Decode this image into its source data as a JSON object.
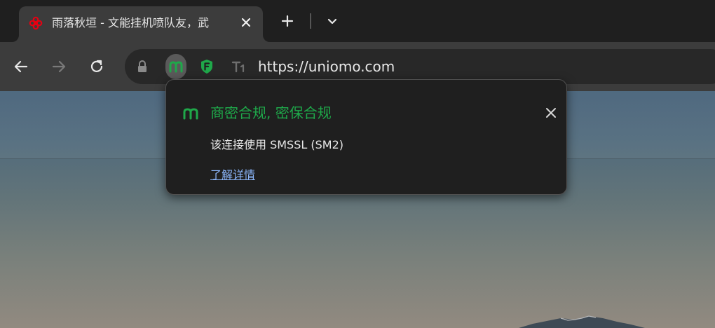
{
  "tab": {
    "title": "雨落秋垣 - 文能挂机喷队友，武",
    "favicon": "unicom-logo-icon",
    "favicon_color": "#e60012"
  },
  "tabstrip": {
    "new_tab_icon": "plus-icon",
    "tab_list_icon": "chevron-down-icon"
  },
  "toolbar": {
    "back_icon": "arrow-left-icon",
    "forward_icon": "arrow-right-icon",
    "reload_icon": "reload-icon"
  },
  "omnibox": {
    "url": "https://uniomo.com",
    "icons": [
      "lock-icon",
      "smssl-m-icon",
      "shield-f-icon",
      "text-t1-icon"
    ]
  },
  "popup": {
    "title": "商密合规, 密保合规",
    "description": "该连接使用 SMSSL (SM2)",
    "link": "了解详情",
    "accent_color": "#1fa84a",
    "link_color": "#8ab4f8"
  }
}
